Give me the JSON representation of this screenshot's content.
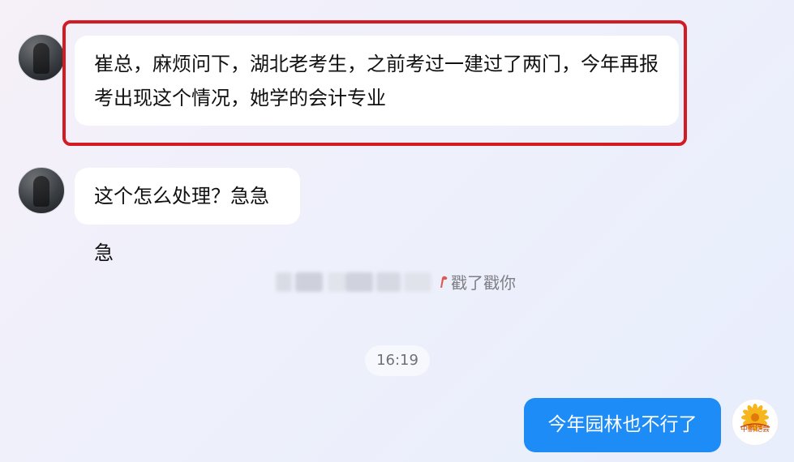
{
  "messages": [
    {
      "sender": "contact",
      "text_line1": "崔总，麻烦问下，湖北老考生，之前考过一建过了两门，今年再报",
      "text_line2": "考出现这个情况，她学的会计专业"
    },
    {
      "sender": "contact",
      "text": "这个怎么处理？急急急"
    },
    {
      "sender": "me",
      "text": "今年园林也不行了"
    }
  ],
  "system": {
    "poke_text": "戳了戳你",
    "timestamp": "16:19"
  },
  "colors": {
    "highlight_border": "#d31b23",
    "my_bubble": "#1e8cf6",
    "contact_bubble": "#ffffff",
    "system_text": "#7f7f86"
  },
  "icons": {
    "poke": "poke-hand-icon",
    "my_avatar": "sunflower-logo-avatar"
  },
  "logo_text": "中鹏铠尝"
}
